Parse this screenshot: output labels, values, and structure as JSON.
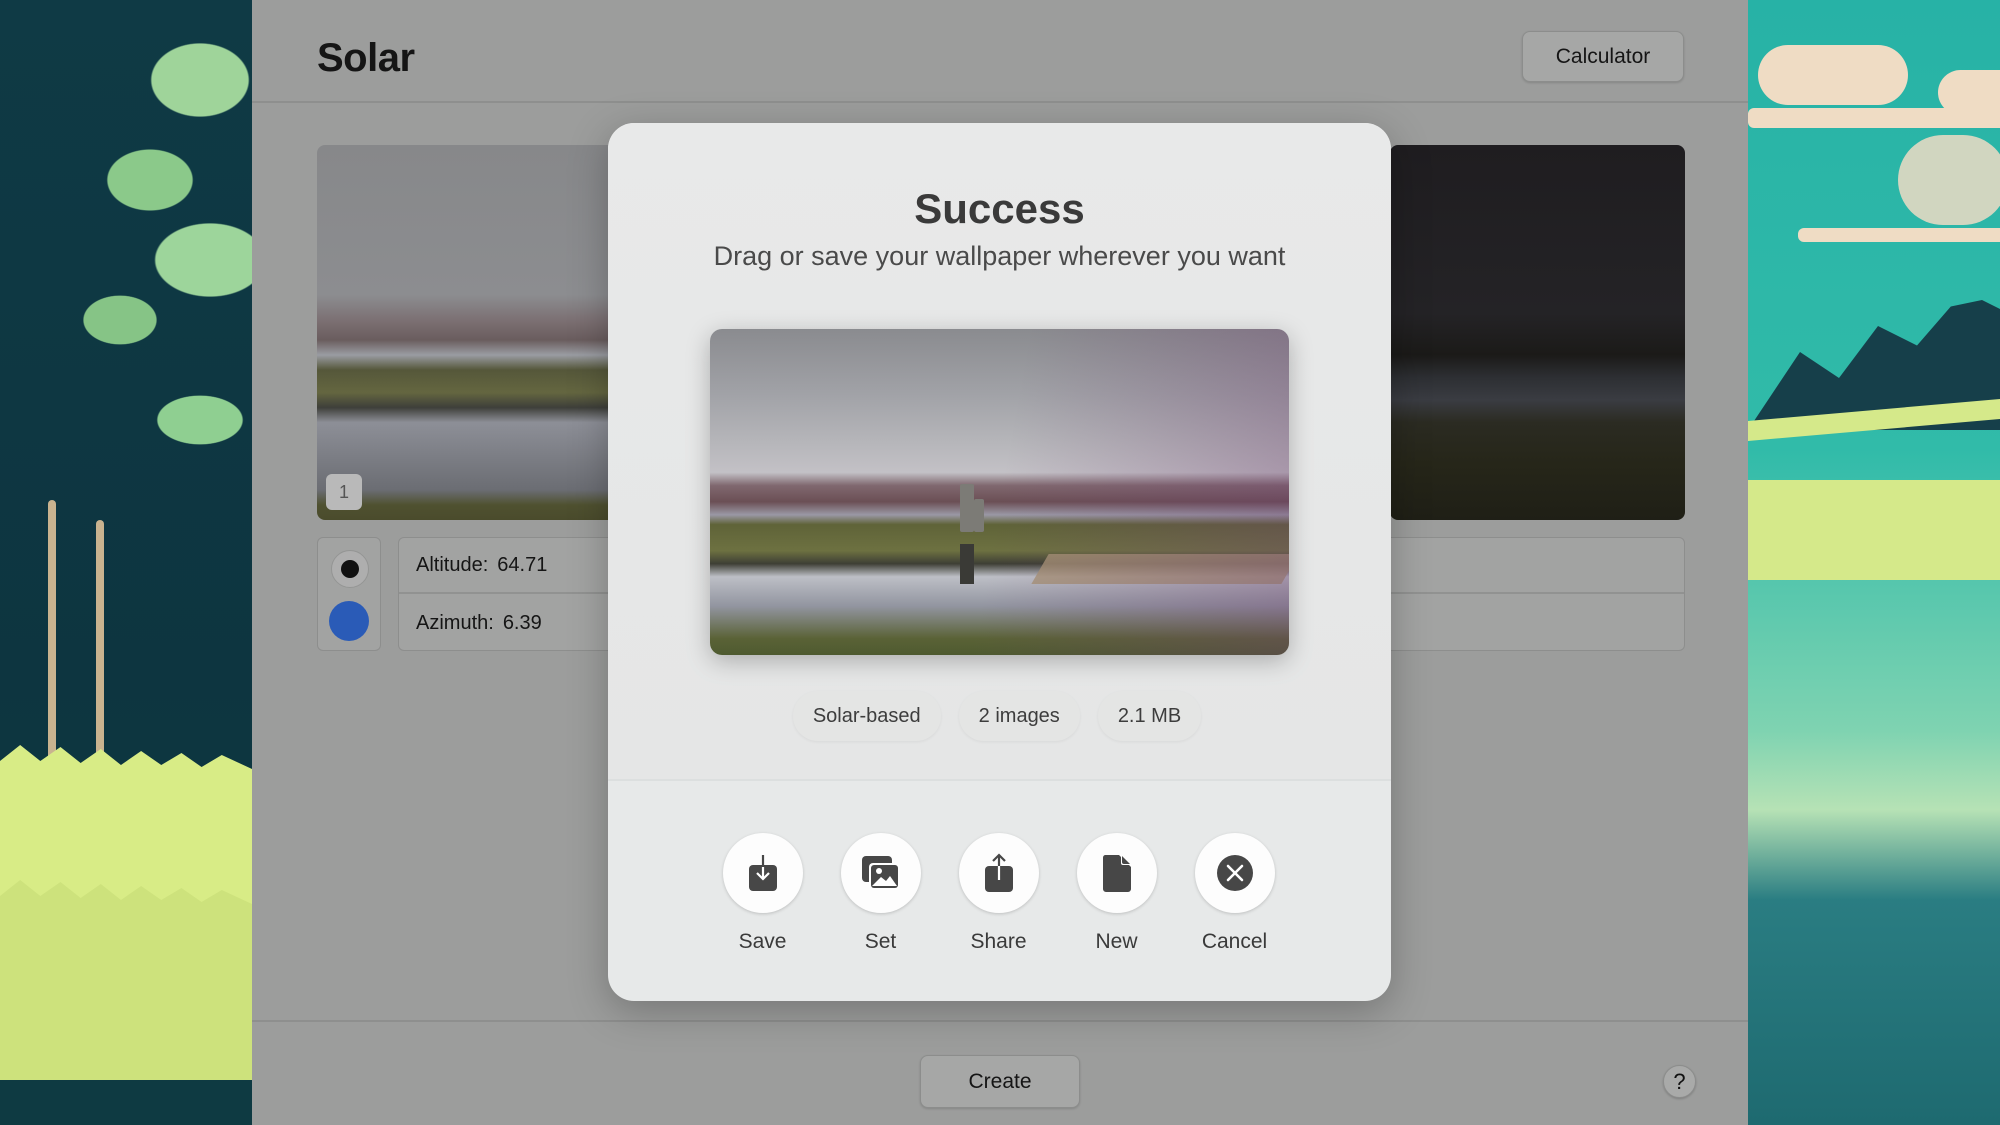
{
  "app": {
    "title": "Solar",
    "calculator_label": "Calculator",
    "create_label": "Create",
    "help_label": "?"
  },
  "thumbnails": [
    {
      "index_label": "1",
      "theme": "light"
    },
    {
      "theme": "dark"
    }
  ],
  "appearance_swatches": [
    {
      "name": "black",
      "color": "#111111",
      "selected": true
    },
    {
      "name": "blue",
      "color": "#2a5bb7",
      "selected": false
    }
  ],
  "sun_position": {
    "altitude_label": "Altitude:",
    "altitude_value": "64.71",
    "azimuth_label": "Azimuth:",
    "azimuth_value": "6.39"
  },
  "modal": {
    "title": "Success",
    "subtitle": "Drag or save your wallpaper wherever you want",
    "tags": [
      "Solar-based",
      "2 images",
      "2.1 MB"
    ],
    "actions": [
      {
        "label": "Save",
        "icon": "save-download-icon"
      },
      {
        "label": "Set",
        "icon": "set-wallpaper-photos-icon"
      },
      {
        "label": "Share",
        "icon": "share-icon"
      },
      {
        "label": "New",
        "icon": "new-document-icon"
      },
      {
        "label": "Cancel",
        "icon": "cancel-x-circle-icon"
      }
    ]
  }
}
